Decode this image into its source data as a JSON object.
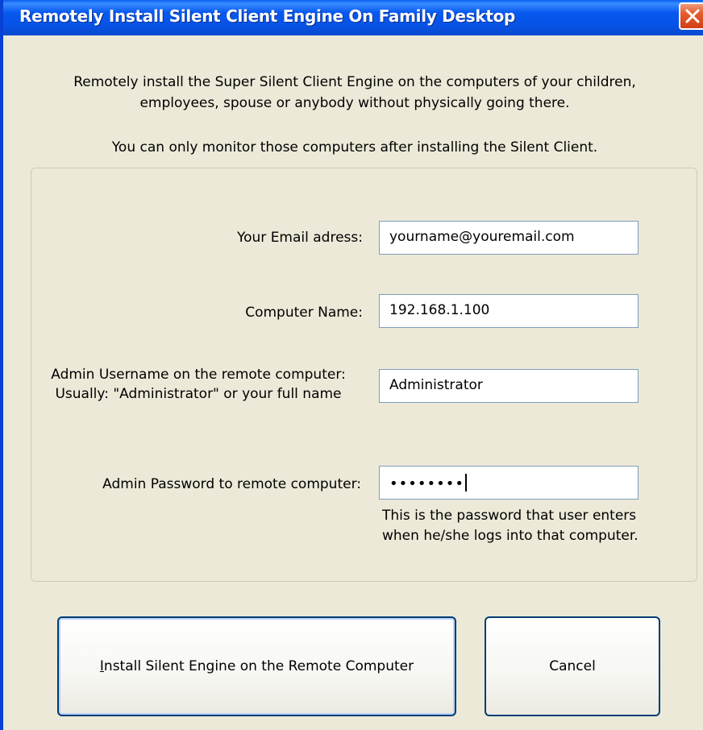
{
  "window": {
    "title": "Remotely Install Silent Client Engine On Family Desktop"
  },
  "intro": {
    "line1": "Remotely install the Super Silent Client Engine on the computers of your children,",
    "line2": "employees, spouse or anybody without physically going there.",
    "line3": "You can only monitor those computers after installing the Silent Client."
  },
  "form": {
    "email_label": "Your Email adress:",
    "email_value": "yourname@youremail.com",
    "computer_label": "Computer Name:",
    "computer_value": "192.168.1.100",
    "username_label_line1": "Admin Username on the remote computer:",
    "username_label_line2": "Usually: \"Administrator\" or your full name",
    "username_value": "Administrator",
    "password_label": "Admin Password to remote computer:",
    "password_value": "••••••••",
    "password_hint_line1": "This is the password that user enters",
    "password_hint_line2": "when he/she logs into that computer."
  },
  "buttons": {
    "install_first_letter": "I",
    "install_rest": "nstall Silent Engine on the Remote Computer",
    "cancel": "Cancel"
  },
  "icons": {
    "close": "close-icon"
  },
  "colors": {
    "titlebar": "#0653e6",
    "close_button": "#e65a2c",
    "dialog_background": "#ece9d8"
  }
}
